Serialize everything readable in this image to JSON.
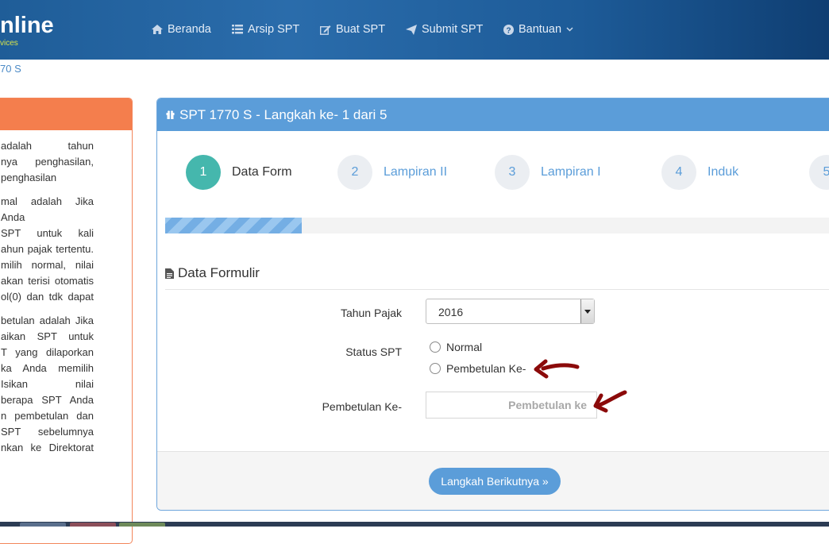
{
  "brand": {
    "name": "nline",
    "tagline": "vices"
  },
  "nav": [
    {
      "label": "Beranda",
      "icon": "home-icon"
    },
    {
      "label": "Arsip SPT",
      "icon": "list-icon"
    },
    {
      "label": "Buat SPT",
      "icon": "edit-icon"
    },
    {
      "label": "Submit SPT",
      "icon": "send-icon"
    },
    {
      "label": "Bantuan",
      "icon": "help-icon"
    }
  ],
  "breadcrumb": "70 S",
  "left_panel": {
    "paragraphs": [
      [
        "adalah tahun",
        "nya penghasilan,",
        "penghasilan"
      ],
      [
        "mal adalah Jika Anda",
        "SPT untuk kali",
        "ahun pajak tertentu.",
        "milih normal, nilai",
        "akan terisi otomatis",
        "ol(0) dan tdk dapat"
      ],
      [
        "betulan adalah Jika",
        "aikan SPT untuk",
        "T yang dilaporkan",
        "ka Anda memilih",
        "Isikan nilai",
        "berapa SPT Anda",
        "n pembetulan dan",
        "SPT sebelumnya",
        "nkan ke Direktorat"
      ]
    ]
  },
  "panel": {
    "title": "SPT 1770 S - Langkah ke- 1 dari 5",
    "steps": [
      {
        "num": "1",
        "label": "Data Form"
      },
      {
        "num": "2",
        "label": "Lampiran II"
      },
      {
        "num": "3",
        "label": "Lampiran I"
      },
      {
        "num": "4",
        "label": "Induk"
      },
      {
        "num": "5",
        "label": ""
      }
    ],
    "progress": 0.2,
    "section_title": "Data Formulir",
    "form": {
      "tahun_label": "Tahun Pajak",
      "tahun_value": "2016",
      "status_label": "Status SPT",
      "status_options": [
        "Normal",
        "Pembetulan Ke-"
      ],
      "pembetulan_label": "Pembetulan Ke-",
      "pembetulan_placeholder": "Pembetulan ke"
    },
    "next_button": "Langkah Berikutnya »"
  },
  "colors": {
    "accent": "#5b9dd9",
    "active_step": "#45b7ad",
    "left_header": "#f47e4d",
    "annotation_arrow": "#8b0a0a"
  }
}
